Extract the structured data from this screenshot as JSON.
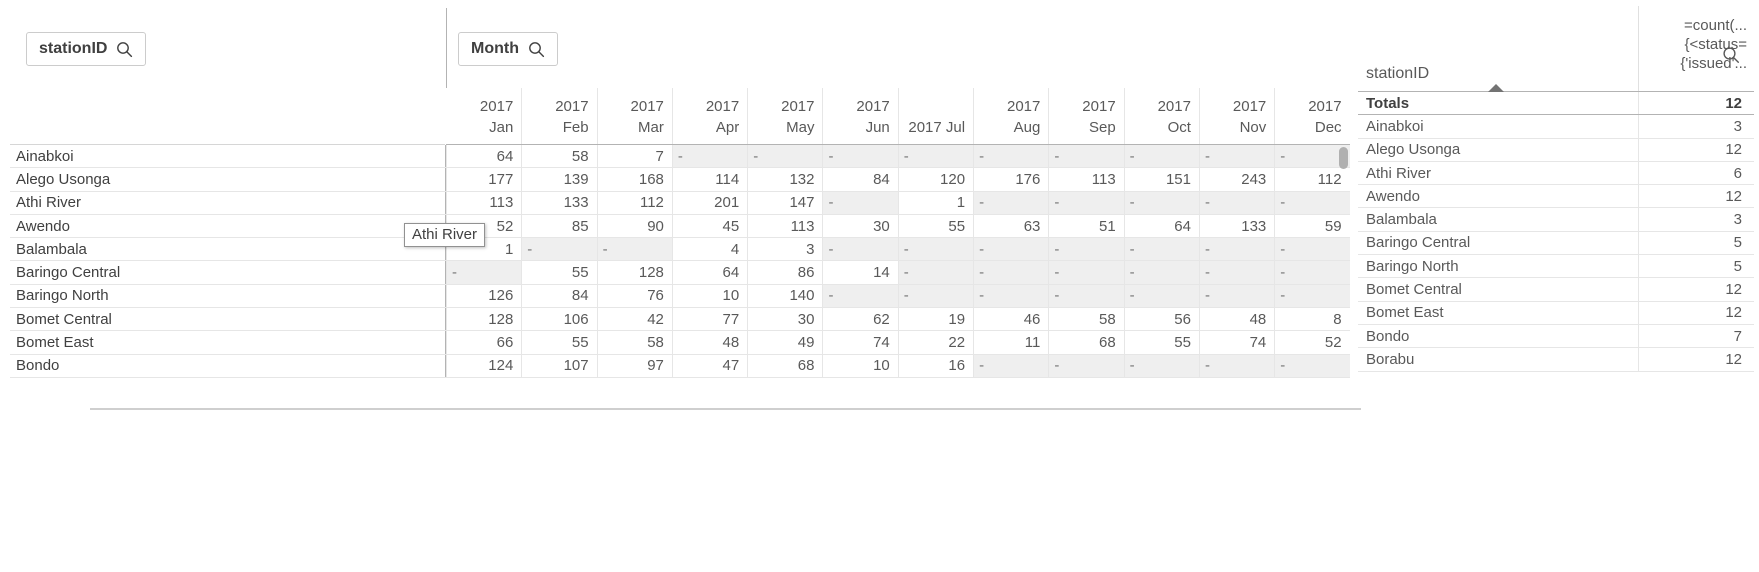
{
  "pivot": {
    "row_dimension_button": {
      "label": "stationID",
      "icon": "search-icon"
    },
    "column_dimension_button": {
      "label": "Month",
      "icon": "search-icon"
    },
    "column_headers": [
      {
        "line1": "2017",
        "line2": "Jan",
        "single": ""
      },
      {
        "line1": "2017",
        "line2": "Feb",
        "single": ""
      },
      {
        "line1": "2017",
        "line2": "Mar",
        "single": ""
      },
      {
        "line1": "2017",
        "line2": "Apr",
        "single": ""
      },
      {
        "line1": "2017",
        "line2": "May",
        "single": ""
      },
      {
        "line1": "2017",
        "line2": "Jun",
        "single": ""
      },
      {
        "line1": "",
        "line2": "2017 Jul",
        "single": "2017 Jul"
      },
      {
        "line1": "2017",
        "line2": "Aug",
        "single": ""
      },
      {
        "line1": "2017",
        "line2": "Sep",
        "single": ""
      },
      {
        "line1": "2017",
        "line2": "Oct",
        "single": ""
      },
      {
        "line1": "2017",
        "line2": "Nov",
        "single": ""
      },
      {
        "line1": "2017",
        "line2": "Dec",
        "single": ""
      }
    ],
    "null_symbol": "-",
    "rows": [
      {
        "label": "Ainabkoi",
        "values": [
          "64",
          "58",
          "7",
          "-",
          "-",
          "-",
          "-",
          "-",
          "-",
          "-",
          "-",
          "-"
        ]
      },
      {
        "label": "Alego Usonga",
        "values": [
          "177",
          "139",
          "168",
          "114",
          "132",
          "84",
          "120",
          "176",
          "113",
          "151",
          "243",
          "112"
        ]
      },
      {
        "label": "Athi River",
        "values": [
          "113",
          "133",
          "112",
          "201",
          "147",
          "-",
          "1",
          "-",
          "-",
          "-",
          "-",
          "-"
        ]
      },
      {
        "label": "Awendo",
        "values": [
          "52",
          "85",
          "90",
          "45",
          "113",
          "30",
          "55",
          "63",
          "51",
          "64",
          "133",
          "59"
        ]
      },
      {
        "label": "Balambala",
        "values": [
          "1",
          "-",
          "-",
          "4",
          "3",
          "-",
          "-",
          "-",
          "-",
          "-",
          "-",
          "-"
        ]
      },
      {
        "label": "Baringo Central",
        "values": [
          "-",
          "55",
          "128",
          "64",
          "86",
          "14",
          "-",
          "-",
          "-",
          "-",
          "-",
          "-"
        ]
      },
      {
        "label": "Baringo North",
        "values": [
          "126",
          "84",
          "76",
          "10",
          "140",
          "-",
          "-",
          "-",
          "-",
          "-",
          "-",
          "-"
        ]
      },
      {
        "label": "Bomet Central",
        "values": [
          "128",
          "106",
          "42",
          "77",
          "30",
          "62",
          "19",
          "46",
          "58",
          "56",
          "48",
          "8"
        ]
      },
      {
        "label": "Bomet East",
        "values": [
          "66",
          "55",
          "58",
          "48",
          "49",
          "74",
          "22",
          "11",
          "68",
          "55",
          "74",
          "52"
        ]
      },
      {
        "label": "Bondo",
        "values": [
          "124",
          "107",
          "97",
          "47",
          "68",
          "10",
          "16",
          "-",
          "-",
          "-",
          "-",
          "-"
        ]
      }
    ]
  },
  "table": {
    "dimension_header": "stationID",
    "search_icon": "search-icon",
    "sort_indicator": "sort-ascending-arrow",
    "measure_header_lines": [
      "=count(...",
      "{<status=",
      "{'issued'..."
    ],
    "totals_label": "Totals",
    "totals_value": "12",
    "rows": [
      {
        "label": "Ainabkoi",
        "value": "3"
      },
      {
        "label": "Alego Usonga",
        "value": "12"
      },
      {
        "label": "Athi River",
        "value": "6"
      },
      {
        "label": "Awendo",
        "value": "12"
      },
      {
        "label": "Balambala",
        "value": "3"
      },
      {
        "label": "Baringo Central",
        "value": "5"
      },
      {
        "label": "Baringo North",
        "value": "5"
      },
      {
        "label": "Bomet Central",
        "value": "12"
      },
      {
        "label": "Bomet East",
        "value": "12"
      },
      {
        "label": "Bondo",
        "value": "7"
      },
      {
        "label": "Borabu",
        "value": "12"
      }
    ]
  },
  "tooltip": {
    "text": "Athi River"
  },
  "colors": {
    "text": "#595959",
    "text_strong": "#404040",
    "null_cell_bg": "#efefef",
    "grid_line": "#e6e6e6",
    "strong_line": "#b3b3b3"
  }
}
